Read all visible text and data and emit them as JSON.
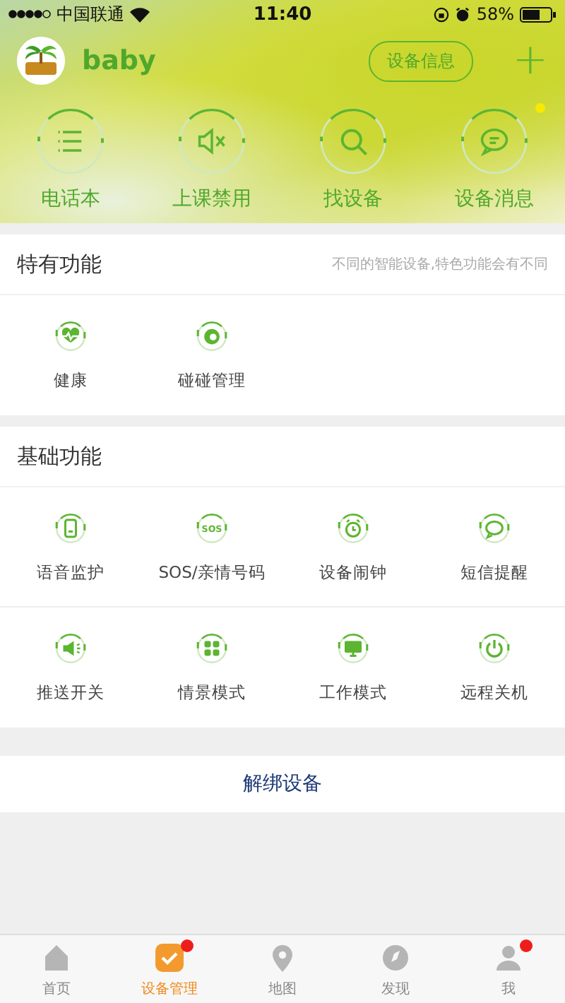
{
  "status_bar": {
    "carrier": "中国联通",
    "time": "11:40",
    "battery": "58%"
  },
  "header": {
    "name": "baby",
    "info_button": "设备信息",
    "add_button": "+"
  },
  "quick_actions": [
    {
      "label": "电话本",
      "dot": false
    },
    {
      "label": "上课禁用",
      "dot": false
    },
    {
      "label": "找设备",
      "dot": false
    },
    {
      "label": "设备消息",
      "dot": true
    }
  ],
  "special": {
    "title": "特有功能",
    "note": "不同的智能设备,特色功能会有不同",
    "items": [
      {
        "label": "健康"
      },
      {
        "label": "碰碰管理"
      }
    ]
  },
  "basic": {
    "title": "基础功能",
    "items": [
      {
        "label": "语音监护"
      },
      {
        "label": "SOS/亲情号码",
        "icon_label": "SOS"
      },
      {
        "label": "设备闹钟"
      },
      {
        "label": "短信提醒"
      },
      {
        "label": "推送开关"
      },
      {
        "label": "情景模式"
      },
      {
        "label": "工作模式"
      },
      {
        "label": "远程关机"
      }
    ]
  },
  "unbind_button": "解绑设备",
  "tab_bar": [
    {
      "label": "首页",
      "selected": false,
      "badge": false
    },
    {
      "label": "设备管理",
      "selected": true,
      "badge": true
    },
    {
      "label": "地图",
      "selected": false,
      "badge": false
    },
    {
      "label": "发现",
      "selected": false,
      "badge": false
    },
    {
      "label": "我",
      "selected": false,
      "badge": true
    }
  ]
}
